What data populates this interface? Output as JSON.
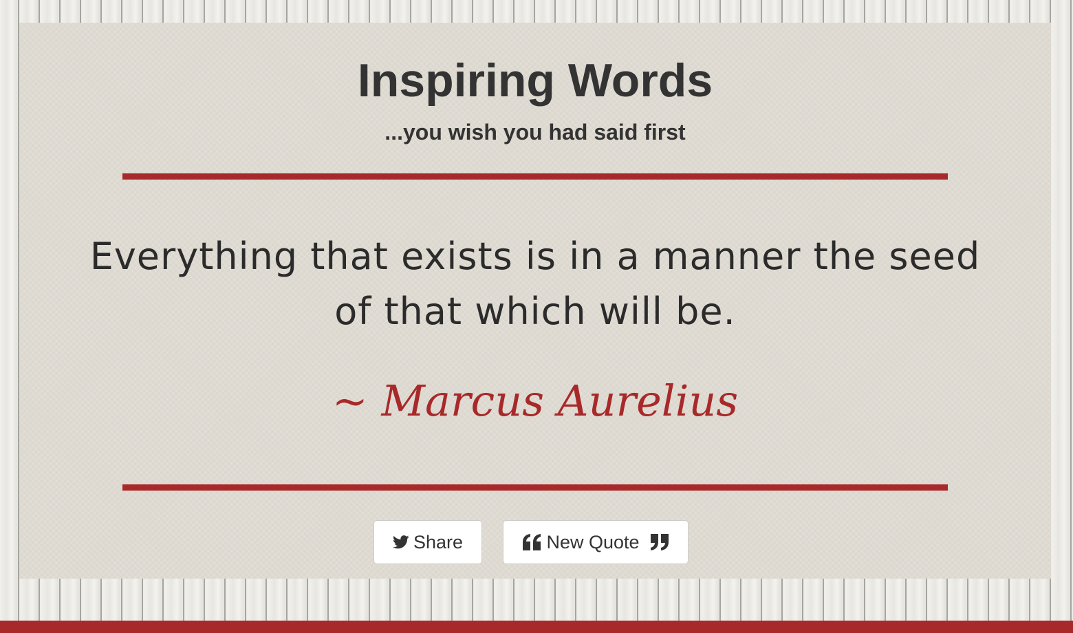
{
  "header": {
    "title": "Inspiring Words",
    "subtitle": "...you wish you had said first"
  },
  "quote": {
    "text": "Everything that exists is in a manner the seed of that which will be.",
    "author": "~ Marcus Aurelius"
  },
  "actions": {
    "share_label": "Share",
    "new_quote_label": "New Quote"
  },
  "icons": {
    "share": "twitter-icon",
    "new_quote_left": "quote-left-icon",
    "new_quote_right": "quote-right-icon"
  },
  "colors": {
    "accent": "#a8292a",
    "text": "#333333",
    "panel": "#dcd8cf",
    "button_bg": "#ffffff"
  }
}
